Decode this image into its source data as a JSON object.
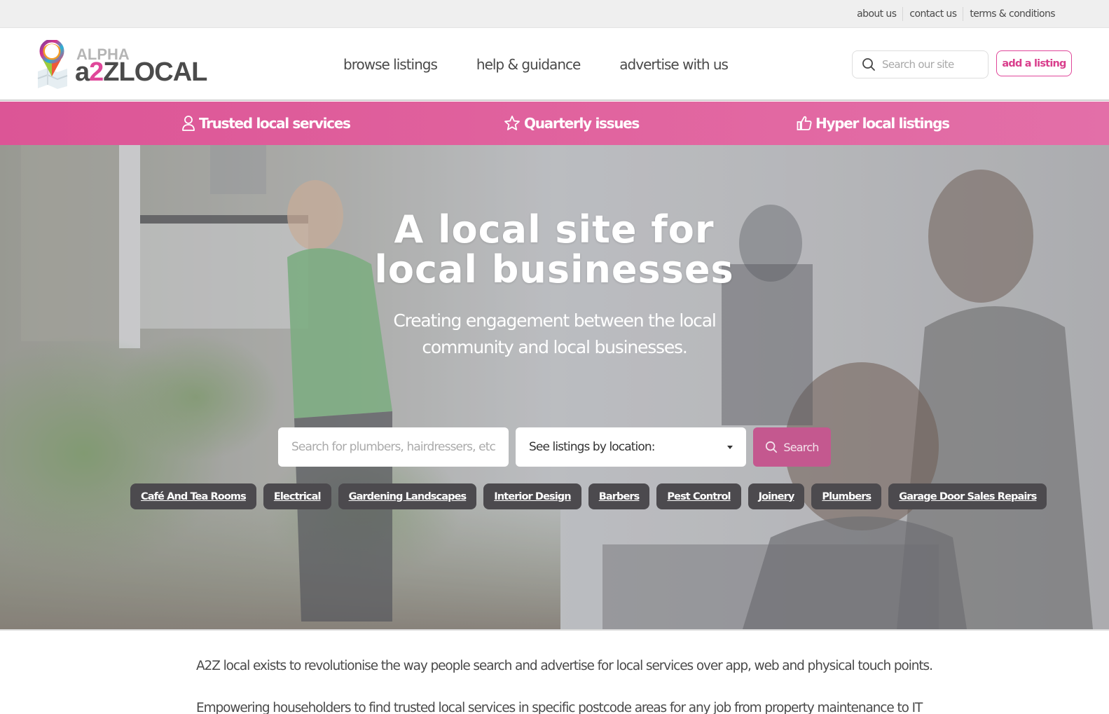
{
  "utility_nav": {
    "links": [
      "about us",
      "contact us",
      "terms & conditions"
    ]
  },
  "brand": {
    "alpha": "ALPHA",
    "name_prefix": "a",
    "name_accent": "2",
    "name_suffix": "ZLOCAL",
    "accent_color": "#e0479a"
  },
  "main_nav": {
    "items": [
      "browse listings",
      "help & guidance",
      "advertise with us"
    ]
  },
  "header_actions": {
    "site_search_placeholder": "Search our site",
    "add_listing_label": "add a listing"
  },
  "feature_band": {
    "color": "#de5a9b",
    "items": [
      {
        "icon": "user-icon",
        "label": "Trusted local services"
      },
      {
        "icon": "star-icon",
        "label": "Quarterly issues"
      },
      {
        "icon": "thumbs-up-icon",
        "label": "Hyper local listings"
      }
    ]
  },
  "hero": {
    "title": "A local site for local businesses",
    "subtitle_line1": "Creating engagement between the local",
    "subtitle_line2": "community and local businesses.",
    "search_placeholder": "Search for plumbers, hairdressers, etc.",
    "location_select_value": "See listings by location:",
    "search_button_label": "Search",
    "search_button_color": "#c4588f",
    "categories": [
      "Café And Tea Rooms",
      "Electrical",
      "Gardening Landscapes",
      "Interior Design",
      "Barbers",
      "Pest Control",
      "Joinery",
      "Plumbers",
      "Garage Door Sales Repairs"
    ]
  },
  "about": {
    "paragraph1": "A2Z local exists to revolutionise the way people search and advertise for local services over app, web and physical touch points.",
    "paragraph2": "Empowering householders to find trusted local services in specific postcode areas for any job from property maintenance to IT"
  }
}
